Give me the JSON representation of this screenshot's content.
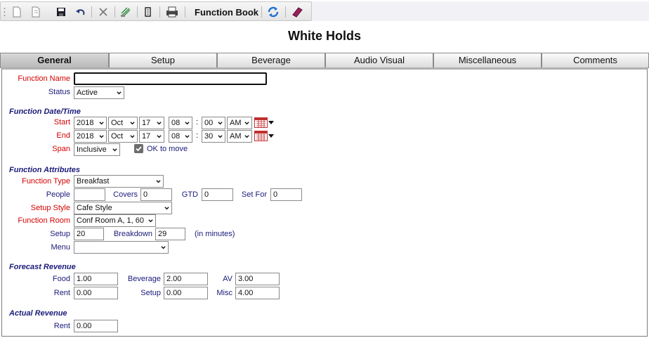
{
  "toolbar": {
    "function_book_label": "Function Book",
    "icons": [
      "new-icon",
      "copy-icon",
      "save-icon",
      "undo-icon",
      "delete-icon",
      "stamp-icon",
      "document-icon",
      "print-icon",
      "refresh-icon",
      "book-icon"
    ]
  },
  "page_title": "White Holds",
  "tabs": [
    {
      "label": "General",
      "active": true
    },
    {
      "label": "Setup"
    },
    {
      "label": "Beverage"
    },
    {
      "label": "Audio Visual"
    },
    {
      "label": "Miscellaneous"
    },
    {
      "label": "Comments"
    }
  ],
  "form": {
    "function_name_label": "Function Name",
    "function_name_value": "",
    "status_label": "Status",
    "status_value": "Active",
    "date_time_section": "Function Date/Time",
    "start_label": "Start",
    "start": {
      "year": "2018",
      "month": "Oct",
      "day": "17",
      "hour": "08",
      "minute": "00",
      "ampm": "AM"
    },
    "end_label": "End",
    "end": {
      "year": "2018",
      "month": "Oct",
      "day": "17",
      "hour": "08",
      "minute": "30",
      "ampm": "AM"
    },
    "colon": ":",
    "span_label": "Span",
    "span_value": "Inclusive",
    "ok_to_move_label": "OK to move",
    "ok_to_move_checked": true,
    "attributes_section": "Function Attributes",
    "function_type_label": "Function Type",
    "function_type_value": "Breakfast",
    "people_label": "People",
    "people_value": "",
    "covers_label": "Covers",
    "covers_value": "0",
    "gtd_label": "GTD",
    "gtd_value": "0",
    "set_for_label": "Set For",
    "set_for_value": "0",
    "setup_style_label": "Setup Style",
    "setup_style_value": "Cafe Style",
    "function_room_label": "Function Room",
    "function_room_value": "Conf Room A, 1, 60",
    "setup_label": "Setup",
    "setup_value": "20",
    "breakdown_label": "Breakdown",
    "breakdown_value": "29",
    "minutes_note": "(in minutes)",
    "menu_label": "Menu",
    "menu_value": "",
    "forecast_section": "Forecast Revenue",
    "food_label": "Food",
    "food_value": "1.00",
    "beverage_label": "Beverage",
    "beverage_value": "2.00",
    "av_label": "AV",
    "av_value": "3.00",
    "rent_label": "Rent",
    "rent_value": "0.00",
    "setup_rev_label": "Setup",
    "setup_rev_value": "0.00",
    "misc_label": "Misc",
    "misc_value": "4.00",
    "actual_section": "Actual Revenue",
    "actual_rent_label": "Rent",
    "actual_rent_value": "0.00"
  },
  "colors": {
    "required_label": "#d40000",
    "label": "#1a1a7a",
    "accent_blue": "#1e6fd0"
  }
}
